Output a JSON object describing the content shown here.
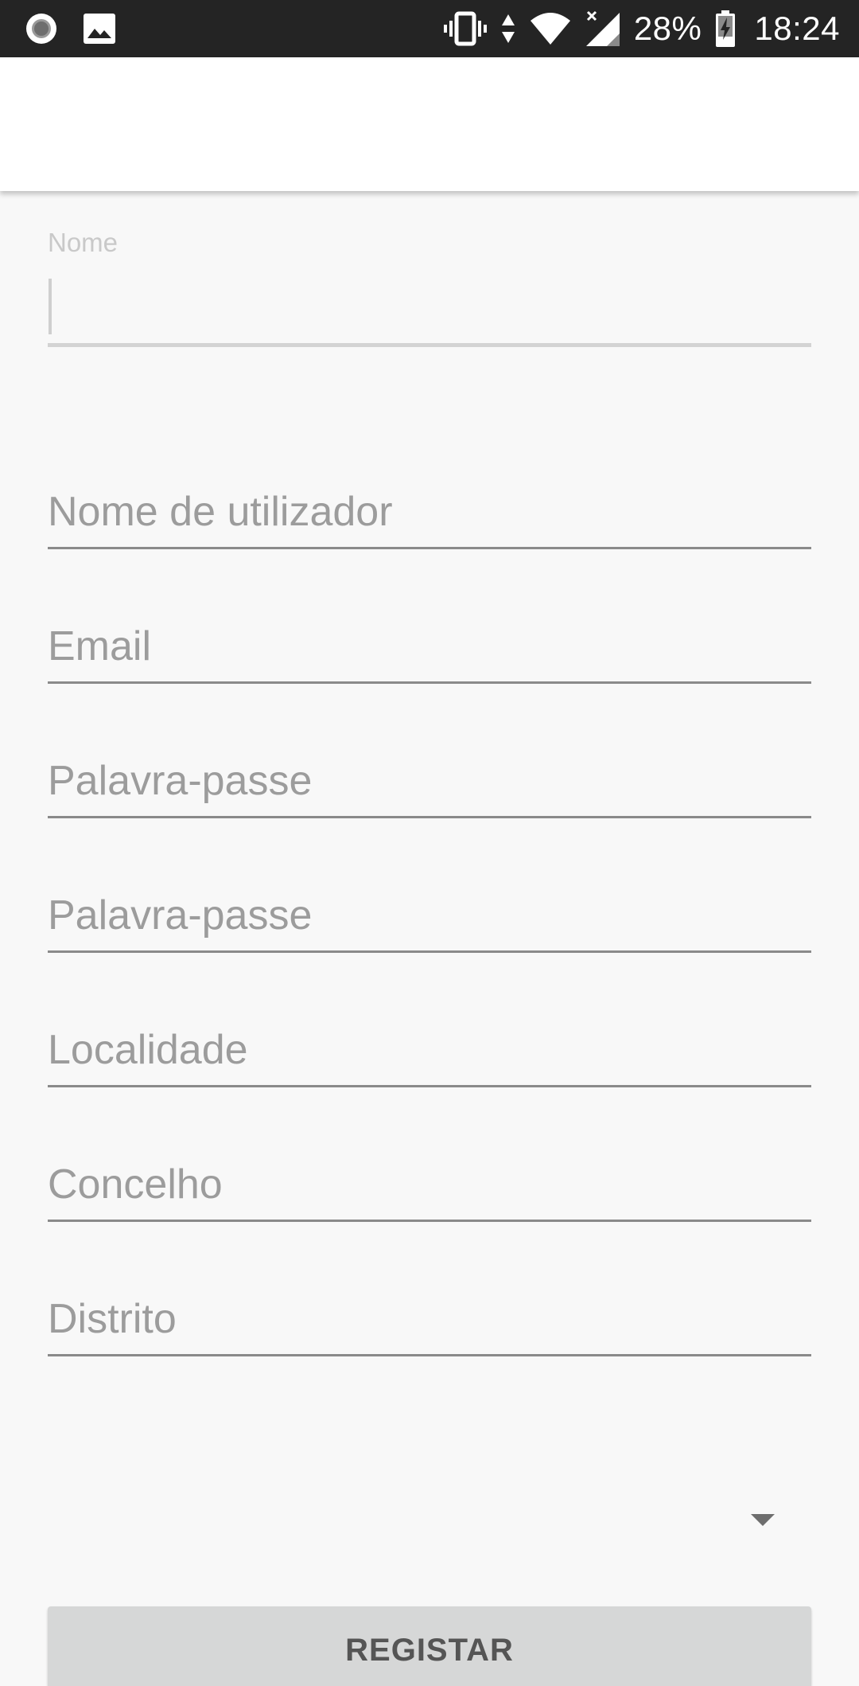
{
  "status_bar": {
    "battery_percent": "28%",
    "time": "18:24",
    "icons": [
      "record-icon",
      "image-icon",
      "vibrate-icon",
      "data-arrows-icon",
      "wifi-icon",
      "signal-icon",
      "battery-charging-icon"
    ]
  },
  "form": {
    "nome_label": "Nome",
    "nome_value": "",
    "fields": [
      {
        "placeholder": "Nome de utilizador",
        "value": ""
      },
      {
        "placeholder": "Email",
        "value": ""
      },
      {
        "placeholder": "Palavra-passe",
        "value": ""
      },
      {
        "placeholder": "Palavra-passe",
        "value": ""
      },
      {
        "placeholder": "Localidade",
        "value": ""
      },
      {
        "placeholder": "Concelho",
        "value": ""
      },
      {
        "placeholder": "Distrito",
        "value": ""
      }
    ],
    "register_label": "REGISTAR"
  },
  "colors": {
    "status_bar_bg": "#242424",
    "app_bar_bg": "#ffffff",
    "page_bg": "#f8f8f8",
    "button_bg": "#d6d7d7",
    "hint_text": "#9c9c9c",
    "underline": "#8a8a8a"
  }
}
